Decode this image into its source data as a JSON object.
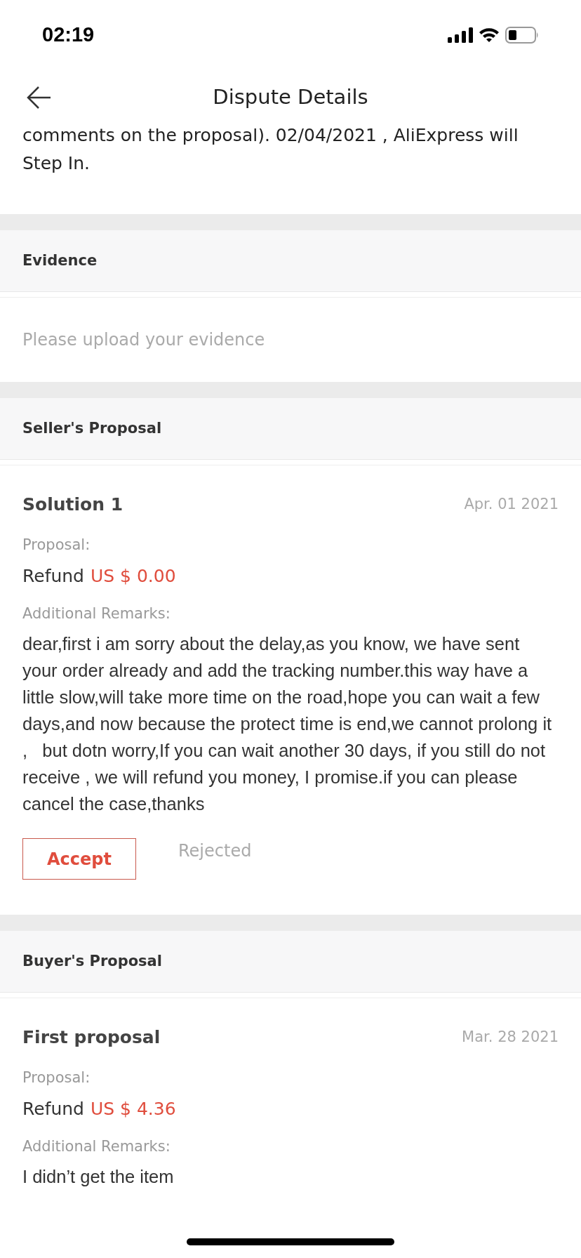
{
  "status_bar": {
    "time": "02:19"
  },
  "header": {
    "title": "Dispute Details"
  },
  "notice": {
    "lines": [
      "comments on the proposal). 02/04/2021 , AliExpress will",
      "Step In."
    ]
  },
  "evidence": {
    "title": "Evidence",
    "placeholder": "Please upload your evidence"
  },
  "sections": [
    {
      "title": "Seller's Proposal",
      "proposal": {
        "name": "Solution 1",
        "date": "Apr. 01 2021",
        "proposal_label": "Proposal:",
        "refund_label": "Refund",
        "amount": "US $ 0.00",
        "remarks_label": "Additional Remarks:",
        "remarks": "dear,first i am sorry about the delay,as you know, we have sent your order already and add the tracking number.this way have a little slow,will take more time on the road,hope you can wait a few days,and now because the protect time is end,we cannot prolong it ,   but dotn worry,If you can wait another 30 days, if you still do not receive , we will refund you money, I promise.if you can please cancel the case,thanks",
        "actions": [
          {
            "kind": "primary",
            "label": "Accept"
          },
          {
            "kind": "text",
            "label": "Rejected"
          }
        ]
      }
    },
    {
      "title": "Buyer's Proposal",
      "proposal": {
        "name": "First proposal",
        "date": "Mar. 28 2021",
        "proposal_label": "Proposal:",
        "refund_label": "Refund",
        "amount": "US $ 4.36",
        "remarks_label": "Additional Remarks:",
        "remarks": "I didn’t get the item"
      }
    }
  ]
}
